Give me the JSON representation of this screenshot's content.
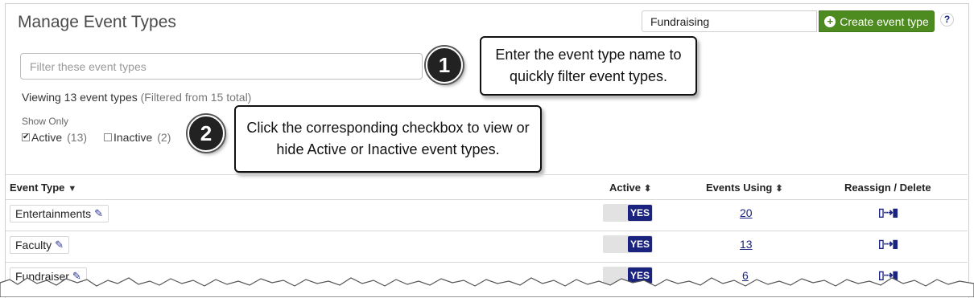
{
  "header": {
    "title": "Manage Event Types",
    "event_type_input_value": "Fundraising",
    "create_button_label": "Create event type",
    "help_label": "?"
  },
  "filter": {
    "placeholder": "Filter these event types"
  },
  "summary": {
    "viewing": "Viewing 13 event types",
    "filtered": "(Filtered from 15 total)"
  },
  "show_only": {
    "label": "Show Only",
    "active_label": "Active",
    "active_count": "(13)",
    "active_checked": true,
    "inactive_label": "Inactive",
    "inactive_count": "(2)",
    "inactive_checked": false
  },
  "callouts": [
    {
      "number": "1",
      "text": "Enter the event type name to quickly filter event types."
    },
    {
      "number": "2",
      "text": "Click the corresponding checkbox to view or hide Active or Inactive event types."
    }
  ],
  "table": {
    "columns": [
      "Event Type",
      "Active",
      "Events Using",
      "Reassign / Delete"
    ],
    "rows": [
      {
        "name": "Entertainments",
        "active": "YES",
        "events_using": "20"
      },
      {
        "name": "Faculty",
        "active": "YES",
        "events_using": "13"
      },
      {
        "name": "Fundraiser",
        "active": "YES",
        "events_using": "6"
      }
    ]
  },
  "icons": {
    "create": "plus-circle-icon",
    "edit": "pencil-icon",
    "reassign": "reassign-delete-icon",
    "sort_desc": "caret-down-icon",
    "sort_both": "sort-icon"
  },
  "colors": {
    "create_button": "#4d8a1f",
    "toggle_yes": "#1a237e",
    "link": "#1a237e",
    "badge": "#222222"
  }
}
